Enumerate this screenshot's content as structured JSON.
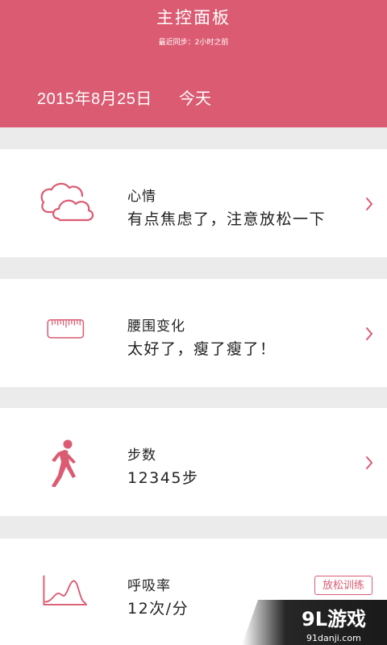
{
  "header": {
    "title": "主控面板",
    "sync_status": "最近同步：2小时之前",
    "date": "2015年8月25日",
    "today_label": "今天"
  },
  "cards": [
    {
      "label": "心情",
      "value": "有点焦虑了，注意放松一下",
      "icon": "cloud-icon"
    },
    {
      "label": "腰围变化",
      "value": "太好了，瘦了瘦了！",
      "icon": "ruler-icon"
    },
    {
      "label": "步数",
      "value": "12345步",
      "icon": "walking-person-icon"
    },
    {
      "label": "呼吸率",
      "value": "12次/分",
      "icon": "breathing-chart-icon",
      "action_label": "放松训练"
    }
  ],
  "watermark": {
    "logo": "9L游戏",
    "url": "91danji.com"
  },
  "colors": {
    "accent": "#db5b72",
    "background": "#ebebeb",
    "card": "#ffffff"
  }
}
